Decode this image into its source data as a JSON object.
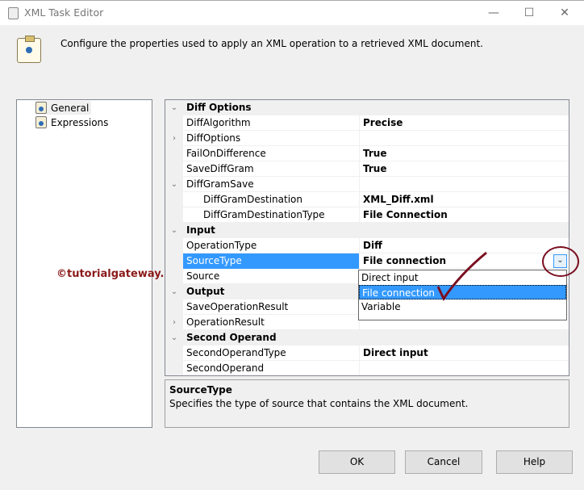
{
  "window": {
    "title": "XML Task Editor",
    "minimize": "—",
    "maximize": "☐",
    "close": "✕"
  },
  "header": {
    "text": "Configure the properties used to apply an XML operation to a retrieved XML document."
  },
  "nav": [
    {
      "label": "General"
    },
    {
      "label": "Expressions"
    }
  ],
  "grid": {
    "rows": [
      {
        "type": "cat",
        "label": "Diff Options",
        "exp": "⌄"
      },
      {
        "label": "DiffAlgorithm",
        "value": "Precise"
      },
      {
        "label": "DiffOptions",
        "value": "",
        "exp": "›"
      },
      {
        "label": "FailOnDifference",
        "value": "True"
      },
      {
        "label": "SaveDiffGram",
        "value": "True"
      },
      {
        "label": "DiffGramSave",
        "value": "",
        "exp": "⌄"
      },
      {
        "type": "sub",
        "label": "DiffGramDestination",
        "value": "XML_Diff.xml"
      },
      {
        "type": "sub",
        "label": "DiffGramDestinationType",
        "value": "File Connection"
      },
      {
        "type": "cat",
        "label": "Input",
        "exp": "⌄"
      },
      {
        "label": "OperationType",
        "value": "Diff"
      },
      {
        "type": "sel",
        "label": "SourceType",
        "value": "File connection"
      },
      {
        "label": "Source",
        "value": ""
      },
      {
        "type": "cat",
        "label": "Output",
        "exp": "⌄"
      },
      {
        "label": "SaveOperationResult",
        "value": ""
      },
      {
        "label": "OperationResult",
        "value": "",
        "exp": "›"
      },
      {
        "type": "cat",
        "label": "Second Operand",
        "exp": "⌄"
      },
      {
        "label": "SecondOperandType",
        "value": "Direct input"
      },
      {
        "label": "SecondOperand",
        "value": ""
      }
    ]
  },
  "dropdown": {
    "options": [
      "Direct input",
      "File connection",
      "Variable"
    ],
    "selected": "File connection"
  },
  "description": {
    "title": "SourceType",
    "text": "Specifies the type of source that contains the XML document."
  },
  "buttons": {
    "ok": "OK",
    "cancel": "Cancel",
    "help": "Help"
  },
  "watermark": "©tutorialgateway.org"
}
